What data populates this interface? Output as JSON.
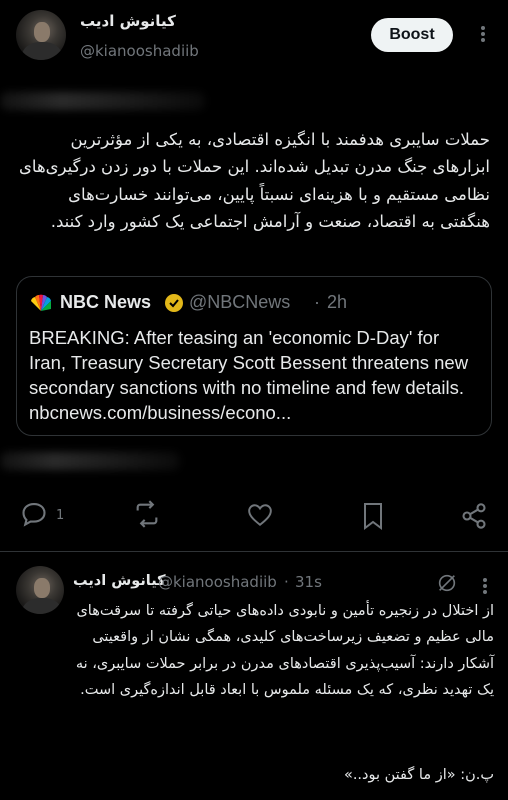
{
  "post1": {
    "display_name": "کیانوش ادیب",
    "handle": "@kianooshadiib",
    "boost_label": "Boost",
    "body": "حملات سایبری هدفمند با انگیزه اقتصادی، به یکی از مؤثرترین ابزارهای جنگ مدرن تبدیل شده‌اند. این حملات با دور زدن درگیری‌های نظامی مستقیم و با هزینه‌ای نسبتاً پایین، می‌توانند خسارت‌های هنگفتی به اقتصاد، صنعت و آرامش اجتماعی یک کشور وارد کنند.",
    "quote": {
      "source_name": "NBC News",
      "source_handle": "@NBCNews",
      "separator": "·",
      "time": "2h",
      "text": "BREAKING: After teasing an 'economic D-Day' for Iran, Treasury Secretary Scott Bessent threatens new secondary sanctions with no timeline and few details. nbcnews.com/business/econo..."
    },
    "actions": {
      "reply_icon": "reply-icon",
      "reply_count": "1",
      "repost_icon": "repost-icon",
      "like_icon": "heart-icon",
      "bookmark_icon": "bookmark-icon",
      "share_icon": "share-icon"
    }
  },
  "post2": {
    "display_name": "کیانوش ادیب",
    "handle": "@kianooshadiib",
    "separator": "·",
    "time": "31s",
    "body": "از اختلال در زنجیره تأمین و نابودی داده‌های حیاتی گرفته تا سرقت‌های مالی عظیم و تضعیف زیرساخت‌های کلیدی، همگی نشان از واقعیتی آشکار دارند: آسیب‌پذیری اقتصادهای مدرن در برابر حملات سایبری، نه یک تهدید نظری، که یک مسئله ملموس با ابعاد قابل اندازه‌گیری است.",
    "footer": "پ.ن: «از ما گفتن بود..»"
  },
  "colors": {
    "background": "#000000",
    "text": "#e7e9ea",
    "muted": "#71767b",
    "border": "#2f3336",
    "nbc_verified": "#e2b719"
  }
}
